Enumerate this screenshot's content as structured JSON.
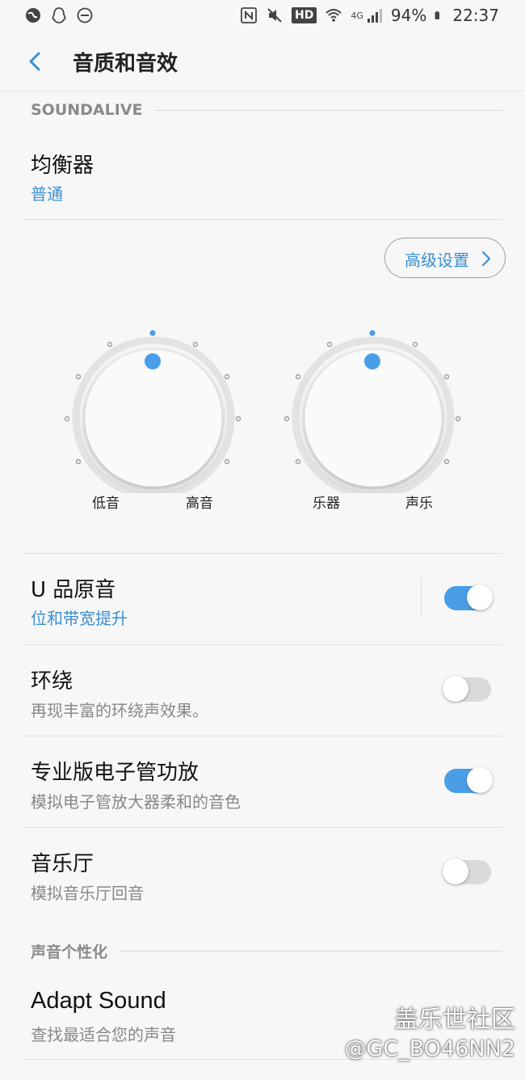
{
  "status_bar": {
    "battery": "94%",
    "time": "22:37",
    "network": "4G",
    "hd": "HD",
    "icons": [
      "circle-globe-icon",
      "qq-icon",
      "do-not-disturb-icon",
      "nfc-icon",
      "mute-icon",
      "hd-icon",
      "wifi-icon",
      "signal-icon",
      "battery-icon"
    ]
  },
  "header": {
    "title": "音质和音效",
    "back_icon": "chevron-left-icon"
  },
  "soundalive": {
    "section_label": "SOUNDALIVE",
    "equalizer": {
      "title": "均衡器",
      "value": "普通"
    },
    "advanced_button": "高级设置",
    "dials": [
      {
        "left_label": "低音",
        "right_label": "高音"
      },
      {
        "left_label": "乐器",
        "right_label": "声乐"
      }
    ]
  },
  "settings": [
    {
      "title": "U 品原音",
      "subtitle": "位和带宽提升",
      "subtitle_accent": true,
      "enabled": true
    },
    {
      "title": "环绕",
      "subtitle": "再现丰富的环绕声效果。",
      "subtitle_accent": false,
      "enabled": false
    },
    {
      "title": "专业版电子管功放",
      "subtitle": "模拟电子管放大器柔和的音色",
      "subtitle_accent": false,
      "enabled": true
    },
    {
      "title": "音乐厅",
      "subtitle": "模拟音乐厅回音",
      "subtitle_accent": false,
      "enabled": false
    }
  ],
  "personalization": {
    "section_label": "声音个性化",
    "adapt_sound": {
      "title": "Adapt Sound",
      "subtitle": "查找最适合您的声音"
    }
  },
  "watermark": {
    "line1": "盖乐世社区",
    "line2": "@GC_BO46NN2"
  },
  "colors": {
    "accent": "#3a8fd1",
    "toggle_on": "#4a9ee8",
    "toggle_off": "#dadada",
    "background": "#f7f7f7"
  }
}
